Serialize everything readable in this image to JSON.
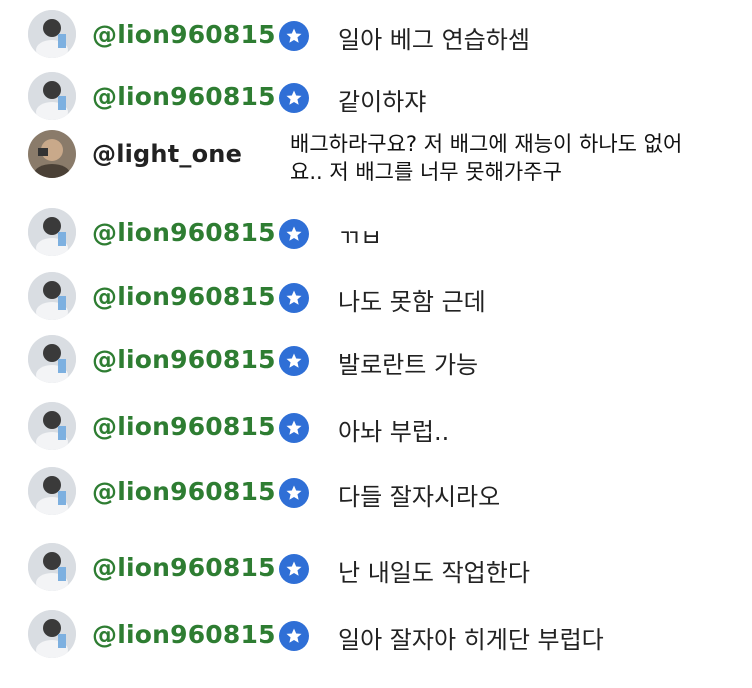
{
  "messages": [
    {
      "user": "@lion960815",
      "verified": true,
      "text": "일아 베그 연습하셈",
      "avatar": "lion"
    },
    {
      "user": "@lion960815",
      "verified": true,
      "text": "같이하쟈",
      "avatar": "lion"
    },
    {
      "user": "@light_one",
      "verified": false,
      "text": "배그하라구요? 저 배그에 재능이 하나도 없어요.. 저 배그를 너무 못해가주구",
      "avatar": "light"
    },
    {
      "user": "@lion960815",
      "verified": true,
      "text": "ㄲㅂ",
      "avatar": "lion"
    },
    {
      "user": "@lion960815",
      "verified": true,
      "text": "나도 못함 근데",
      "avatar": "lion"
    },
    {
      "user": "@lion960815",
      "verified": true,
      "text": "발로란트 가능",
      "avatar": "lion"
    },
    {
      "user": "@lion960815",
      "verified": true,
      "text": "아놔 부럽..",
      "avatar": "lion"
    },
    {
      "user": "@lion960815",
      "verified": true,
      "text": "다들 잘자시라오",
      "avatar": "lion"
    },
    {
      "user": "@lion960815",
      "verified": true,
      "text": "난 내일도 작업한다",
      "avatar": "lion"
    },
    {
      "user": "@lion960815",
      "verified": true,
      "text": "일아 잘자아 히게단 부럽다",
      "avatar": "lion"
    }
  ],
  "colors": {
    "username_green": "#2e7d32",
    "verified_blue": "#2f6fd6",
    "text": "#222222"
  },
  "icons": {
    "verified": "star-in-circle-icon",
    "avatar": "profile-photo"
  }
}
